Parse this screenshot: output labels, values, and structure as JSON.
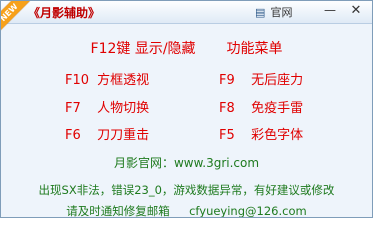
{
  "window": {
    "title": "《月影辅助》",
    "badge": "NEW",
    "site_button": "官网",
    "site_icon": "document-icon",
    "colors": {
      "hotkey_red": "#e00000",
      "info_green": "#1e7a1e",
      "title_red": "#c00000",
      "badge_orange": "#f7a11a"
    }
  },
  "main_toggle": {
    "key": "F12键",
    "action": "显示/隐藏",
    "menu": "功能菜单"
  },
  "hotkeys_left": [
    {
      "key": "F10",
      "label": "方框透视"
    },
    {
      "key": "F7",
      "label": "人物切换"
    },
    {
      "key": "F6",
      "label": "刀刀重击"
    }
  ],
  "hotkeys_right": [
    {
      "key": "F9",
      "label": "无后座力"
    },
    {
      "key": "F8",
      "label": "免疫手雷"
    },
    {
      "key": "F5",
      "label": "彩色字体"
    }
  ],
  "footer": {
    "site": "月影官网：www.3gri.com",
    "notice_line1": "出现SX非法，错误23_0，游戏数据异常，有好建议或修改",
    "notice_line2_prefix": "请及时通知修复邮箱",
    "email": "cfyueying@126.com"
  }
}
